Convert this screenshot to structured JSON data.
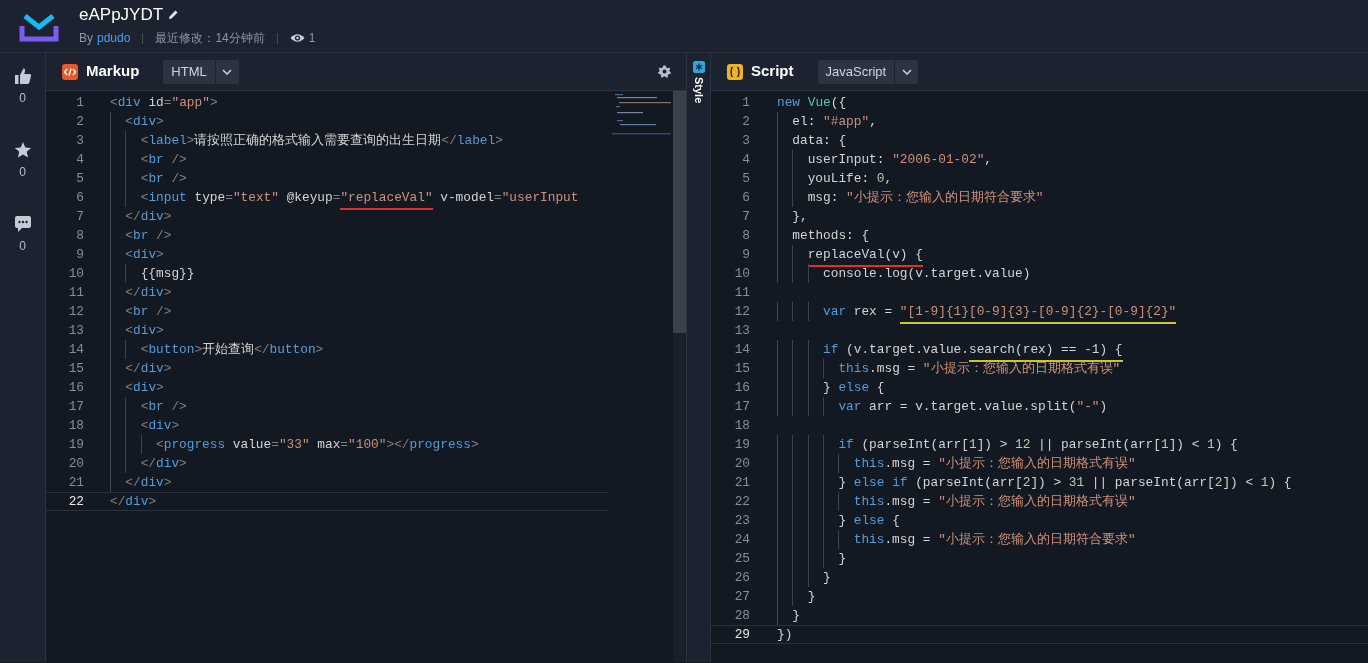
{
  "header": {
    "title": "eAPpJYDT",
    "by": "By",
    "author": "pdudo",
    "modified": "最近修改：14分钟前",
    "views": "1"
  },
  "sidebar": [
    {
      "kind": "like",
      "count": "0"
    },
    {
      "kind": "star",
      "count": "0"
    },
    {
      "kind": "comment",
      "count": "0"
    }
  ],
  "markup": {
    "title": "Markup",
    "language": "HTML",
    "lines": [
      {
        "number": "1",
        "current": false,
        "tokens": [
          {
            "kind": "punct",
            "text": "<"
          },
          {
            "kind": "tag",
            "text": "div"
          },
          {
            "kind": "plain",
            "text": " id"
          },
          {
            "kind": "punct",
            "text": "="
          },
          {
            "kind": "string",
            "text": "\"app\""
          },
          {
            "kind": "punct",
            "text": ">"
          }
        ]
      },
      {
        "number": "2",
        "current": false,
        "tokens": [
          {
            "kind": "punct",
            "text": "  <"
          },
          {
            "kind": "tag",
            "text": "div"
          },
          {
            "kind": "punct",
            "text": ">"
          }
        ]
      },
      {
        "number": "3",
        "current": false,
        "tokens": [
          {
            "kind": "punct",
            "text": "    <"
          },
          {
            "kind": "tag",
            "text": "label"
          },
          {
            "kind": "punct",
            "text": ">"
          },
          {
            "kind": "plain",
            "text": "请按照正确的格式输入需要查询的出生日期"
          },
          {
            "kind": "punct",
            "text": "</"
          },
          {
            "kind": "tag",
            "text": "label"
          },
          {
            "kind": "punct",
            "text": ">"
          }
        ]
      },
      {
        "number": "4",
        "current": false,
        "tokens": [
          {
            "kind": "punct",
            "text": "    <"
          },
          {
            "kind": "tag",
            "text": "br"
          },
          {
            "kind": "punct",
            "text": " />"
          }
        ]
      },
      {
        "number": "5",
        "current": false,
        "tokens": [
          {
            "kind": "punct",
            "text": "    <"
          },
          {
            "kind": "tag",
            "text": "br"
          },
          {
            "kind": "punct",
            "text": " />"
          }
        ]
      },
      {
        "number": "6",
        "current": false,
        "tokens": [
          {
            "kind": "punct",
            "text": "    <"
          },
          {
            "kind": "tag",
            "text": "input"
          },
          {
            "kind": "plain",
            "text": " type"
          },
          {
            "kind": "punct",
            "text": "="
          },
          {
            "kind": "string",
            "text": "\"text\""
          },
          {
            "kind": "plain",
            "text": " @keyup"
          },
          {
            "kind": "punct",
            "text": "="
          },
          {
            "kind": "string",
            "text": "\"replaceVal\"",
            "underline": {
              "color": "#e0302e"
            }
          },
          {
            "kind": "plain",
            "text": " v-model"
          },
          {
            "kind": "punct",
            "text": "="
          },
          {
            "kind": "string",
            "text": "\"userInput"
          }
        ]
      },
      {
        "number": "7",
        "current": false,
        "tokens": [
          {
            "kind": "punct",
            "text": "  </"
          },
          {
            "kind": "tag",
            "text": "div"
          },
          {
            "kind": "punct",
            "text": ">"
          }
        ]
      },
      {
        "number": "8",
        "current": false,
        "tokens": [
          {
            "kind": "punct",
            "text": "  <"
          },
          {
            "kind": "tag",
            "text": "br"
          },
          {
            "kind": "punct",
            "text": " />"
          }
        ]
      },
      {
        "number": "9",
        "current": false,
        "tokens": [
          {
            "kind": "punct",
            "text": "  <"
          },
          {
            "kind": "tag",
            "text": "div"
          },
          {
            "kind": "punct",
            "text": ">"
          }
        ]
      },
      {
        "number": "10",
        "current": false,
        "tokens": [
          {
            "kind": "plain",
            "text": "    {{msg}}"
          }
        ]
      },
      {
        "number": "11",
        "current": false,
        "tokens": [
          {
            "kind": "punct",
            "text": "  </"
          },
          {
            "kind": "tag",
            "text": "div"
          },
          {
            "kind": "punct",
            "text": ">"
          }
        ]
      },
      {
        "number": "12",
        "current": false,
        "tokens": [
          {
            "kind": "punct",
            "text": "  <"
          },
          {
            "kind": "tag",
            "text": "br"
          },
          {
            "kind": "punct",
            "text": " />"
          }
        ]
      },
      {
        "number": "13",
        "current": false,
        "tokens": [
          {
            "kind": "punct",
            "text": "  <"
          },
          {
            "kind": "tag",
            "text": "div"
          },
          {
            "kind": "punct",
            "text": ">"
          }
        ]
      },
      {
        "number": "14",
        "current": false,
        "tokens": [
          {
            "kind": "punct",
            "text": "    <"
          },
          {
            "kind": "tag",
            "text": "button"
          },
          {
            "kind": "punct",
            "text": ">"
          },
          {
            "kind": "plain",
            "text": "开始查询"
          },
          {
            "kind": "punct",
            "text": "</"
          },
          {
            "kind": "tag",
            "text": "button"
          },
          {
            "kind": "punct",
            "text": ">"
          }
        ]
      },
      {
        "number": "15",
        "current": false,
        "tokens": [
          {
            "kind": "punct",
            "text": "  </"
          },
          {
            "kind": "tag",
            "text": "div"
          },
          {
            "kind": "punct",
            "text": ">"
          }
        ]
      },
      {
        "number": "16",
        "current": false,
        "tokens": [
          {
            "kind": "punct",
            "text": "  <"
          },
          {
            "kind": "tag",
            "text": "div"
          },
          {
            "kind": "punct",
            "text": ">"
          }
        ]
      },
      {
        "number": "17",
        "current": false,
        "tokens": [
          {
            "kind": "punct",
            "text": "    <"
          },
          {
            "kind": "tag",
            "text": "br"
          },
          {
            "kind": "punct",
            "text": " />"
          }
        ]
      },
      {
        "number": "18",
        "current": false,
        "tokens": [
          {
            "kind": "punct",
            "text": "    <"
          },
          {
            "kind": "tag",
            "text": "div"
          },
          {
            "kind": "punct",
            "text": ">"
          }
        ]
      },
      {
        "number": "19",
        "current": false,
        "tokens": [
          {
            "kind": "punct",
            "text": "      <"
          },
          {
            "kind": "tag",
            "text": "progress"
          },
          {
            "kind": "plain",
            "text": " value"
          },
          {
            "kind": "punct",
            "text": "="
          },
          {
            "kind": "string",
            "text": "\"33\""
          },
          {
            "kind": "plain",
            "text": " max"
          },
          {
            "kind": "punct",
            "text": "="
          },
          {
            "kind": "string",
            "text": "\"100\""
          },
          {
            "kind": "punct",
            "text": "></"
          },
          {
            "kind": "tag",
            "text": "progress"
          },
          {
            "kind": "punct",
            "text": ">"
          }
        ]
      },
      {
        "number": "20",
        "current": false,
        "tokens": [
          {
            "kind": "punct",
            "text": "    </"
          },
          {
            "kind": "tag",
            "text": "div"
          },
          {
            "kind": "punct",
            "text": ">"
          }
        ]
      },
      {
        "number": "21",
        "current": false,
        "tokens": [
          {
            "kind": "punct",
            "text": "  </"
          },
          {
            "kind": "tag",
            "text": "div"
          },
          {
            "kind": "punct",
            "text": ">"
          }
        ]
      },
      {
        "number": "22",
        "current": true,
        "tokens": [
          {
            "kind": "punct",
            "text": "</"
          },
          {
            "kind": "tag",
            "text": "div"
          },
          {
            "kind": "punct",
            "text": ">"
          }
        ]
      }
    ]
  },
  "style_panel": {
    "title": "Style"
  },
  "script": {
    "title": "Script",
    "language": "JavaScript",
    "lines": [
      {
        "number": "1",
        "current": false,
        "tokens": [
          {
            "kind": "keyword",
            "text": "new"
          },
          {
            "kind": "class",
            "text": " Vue"
          },
          {
            "kind": "plain",
            "text": "({"
          }
        ]
      },
      {
        "number": "2",
        "current": false,
        "tokens": [
          {
            "kind": "plain",
            "text": "  el: "
          },
          {
            "kind": "string",
            "text": "\"#app\""
          },
          {
            "kind": "plain",
            "text": ","
          }
        ]
      },
      {
        "number": "3",
        "current": false,
        "tokens": [
          {
            "kind": "plain",
            "text": "  data: {"
          }
        ]
      },
      {
        "number": "4",
        "current": false,
        "tokens": [
          {
            "kind": "plain",
            "text": "    userInput: "
          },
          {
            "kind": "string",
            "text": "\"2006-01-02\""
          },
          {
            "kind": "plain",
            "text": ","
          }
        ]
      },
      {
        "number": "5",
        "current": false,
        "tokens": [
          {
            "kind": "plain",
            "text": "    youLife: "
          },
          {
            "kind": "number",
            "text": "0"
          },
          {
            "kind": "plain",
            "text": ","
          }
        ]
      },
      {
        "number": "6",
        "current": false,
        "tokens": [
          {
            "kind": "plain",
            "text": "    msg: "
          },
          {
            "kind": "string",
            "text": "\"小提示：您输入的日期符合要求\""
          }
        ]
      },
      {
        "number": "7",
        "current": false,
        "tokens": [
          {
            "kind": "plain",
            "text": "  },"
          }
        ]
      },
      {
        "number": "8",
        "current": false,
        "tokens": [
          {
            "kind": "plain",
            "text": "  methods: {"
          }
        ]
      },
      {
        "number": "9",
        "current": false,
        "tokens": [
          {
            "kind": "plain",
            "text": "    replaceVal(v) {",
            "underline": {
              "color": "#e0302e"
            }
          }
        ]
      },
      {
        "number": "10",
        "current": false,
        "tokens": [
          {
            "kind": "plain",
            "text": "      console.log(v.target.value)"
          }
        ]
      },
      {
        "number": "11",
        "current": false
      },
      {
        "number": "12",
        "current": false,
        "tokens": [
          {
            "kind": "keyword",
            "text": "      var"
          },
          {
            "kind": "plain",
            "text": " rex = "
          },
          {
            "kind": "string",
            "text": "\"[1-9]{1}[0-9]{3}-[0-9]{2}-[0-9]{2}\"",
            "underline": {
              "color": "#c9c826"
            }
          }
        ]
      },
      {
        "number": "13",
        "current": false
      },
      {
        "number": "14",
        "current": false,
        "tokens": [
          {
            "kind": "keyword",
            "text": "      if"
          },
          {
            "kind": "plain",
            "text": " (v.target.value."
          },
          {
            "kind": "plain",
            "text": "search(rex) == -1) {",
            "underline": {
              "color": "#c9c826"
            }
          }
        ]
      },
      {
        "number": "15",
        "current": false,
        "tokens": [
          {
            "kind": "keyword",
            "text": "        this"
          },
          {
            "kind": "plain",
            "text": ".msg = "
          },
          {
            "kind": "string",
            "text": "\"小提示：您输入的日期格式有误\""
          }
        ]
      },
      {
        "number": "16",
        "current": false,
        "tokens": [
          {
            "kind": "plain",
            "text": "      } "
          },
          {
            "kind": "keyword",
            "text": "else"
          },
          {
            "kind": "plain",
            "text": " {"
          }
        ]
      },
      {
        "number": "17",
        "current": false,
        "tokens": [
          {
            "kind": "keyword",
            "text": "        var"
          },
          {
            "kind": "plain",
            "text": " arr = v.target.value.split("
          },
          {
            "kind": "string",
            "text": "\"-\""
          },
          {
            "kind": "plain",
            "text": ")"
          }
        ]
      },
      {
        "number": "18",
        "current": false
      },
      {
        "number": "19",
        "current": false,
        "tokens": [
          {
            "kind": "keyword",
            "text": "        if"
          },
          {
            "kind": "plain",
            "text": " (parseInt(arr["
          },
          {
            "kind": "number",
            "text": "1"
          },
          {
            "kind": "plain",
            "text": "]) > "
          },
          {
            "kind": "number",
            "text": "12"
          },
          {
            "kind": "plain",
            "text": " || parseInt(arr["
          },
          {
            "kind": "number",
            "text": "1"
          },
          {
            "kind": "plain",
            "text": "]) < "
          },
          {
            "kind": "number",
            "text": "1"
          },
          {
            "kind": "plain",
            "text": ") {"
          }
        ]
      },
      {
        "number": "20",
        "current": false,
        "tokens": [
          {
            "kind": "keyword",
            "text": "          this"
          },
          {
            "kind": "plain",
            "text": ".msg = "
          },
          {
            "kind": "string",
            "text": "\"小提示：您输入的日期格式有误\""
          }
        ]
      },
      {
        "number": "21",
        "current": false,
        "tokens": [
          {
            "kind": "plain",
            "text": "        } "
          },
          {
            "kind": "keyword",
            "text": "else if"
          },
          {
            "kind": "plain",
            "text": " (parseInt(arr["
          },
          {
            "kind": "number",
            "text": "2"
          },
          {
            "kind": "plain",
            "text": "]) > "
          },
          {
            "kind": "number",
            "text": "31"
          },
          {
            "kind": "plain",
            "text": " || parseInt(arr["
          },
          {
            "kind": "number",
            "text": "2"
          },
          {
            "kind": "plain",
            "text": "]) < "
          },
          {
            "kind": "number",
            "text": "1"
          },
          {
            "kind": "plain",
            "text": ") {"
          }
        ]
      },
      {
        "number": "22",
        "current": false,
        "tokens": [
          {
            "kind": "keyword",
            "text": "          this"
          },
          {
            "kind": "plain",
            "text": ".msg = "
          },
          {
            "kind": "string",
            "text": "\"小提示：您输入的日期格式有误\""
          }
        ]
      },
      {
        "number": "23",
        "current": false,
        "tokens": [
          {
            "kind": "plain",
            "text": "        } "
          },
          {
            "kind": "keyword",
            "text": "else"
          },
          {
            "kind": "plain",
            "text": " {"
          }
        ]
      },
      {
        "number": "24",
        "current": false,
        "tokens": [
          {
            "kind": "keyword",
            "text": "          this"
          },
          {
            "kind": "plain",
            "text": ".msg = "
          },
          {
            "kind": "string",
            "text": "\"小提示：您输入的日期符合要求\""
          }
        ]
      },
      {
        "number": "25",
        "current": false,
        "tokens": [
          {
            "kind": "plain",
            "text": "        }"
          }
        ]
      },
      {
        "number": "26",
        "current": false,
        "tokens": [
          {
            "kind": "plain",
            "text": "      }"
          }
        ]
      },
      {
        "number": "27",
        "current": false,
        "tokens": [
          {
            "kind": "plain",
            "text": "    }"
          }
        ]
      },
      {
        "number": "28",
        "current": false,
        "tokens": [
          {
            "kind": "plain",
            "text": "  }"
          }
        ]
      },
      {
        "number": "29",
        "current": true,
        "tokens": [
          {
            "kind": "plain",
            "text": "})"
          }
        ]
      }
    ]
  }
}
